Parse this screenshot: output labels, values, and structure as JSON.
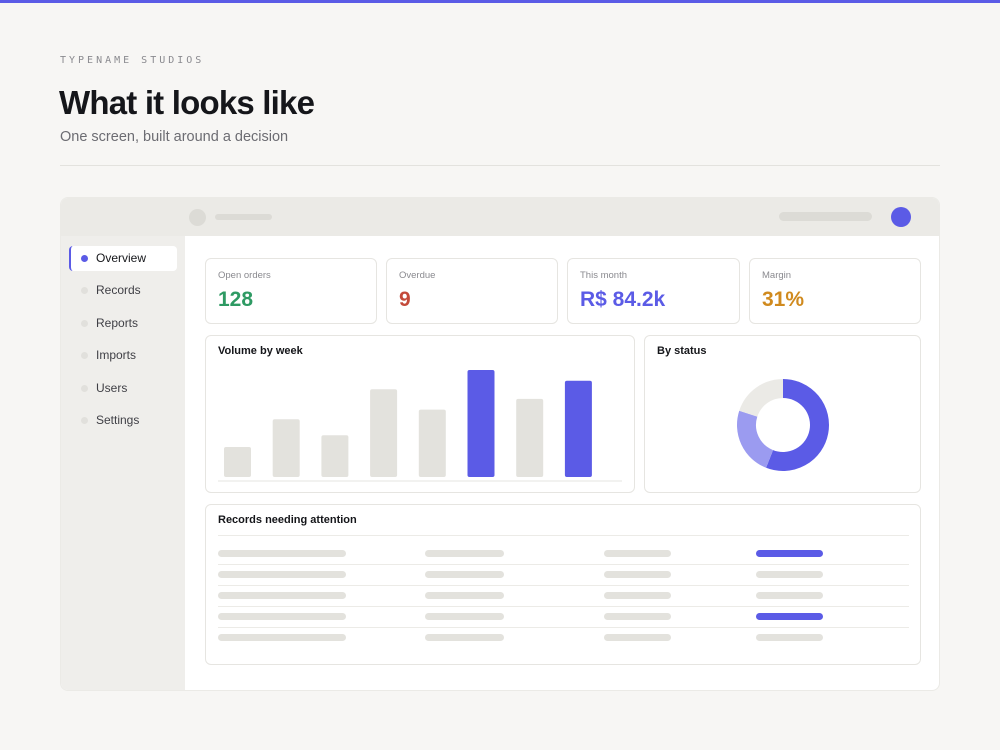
{
  "colors": {
    "accent": "#5b5be6",
    "placeholder": "#e3e2dd",
    "open_orders": "#2e9a63",
    "overdue": "#c44a3a",
    "this_month": "#5b5be6",
    "margin": "#d08a1e"
  },
  "header": {
    "eyebrow": "TYPENAME STUDIOS",
    "title": "What it looks like",
    "subtitle": "One screen, built around a decision"
  },
  "sidebar": {
    "items": [
      {
        "label": "Overview",
        "active": true
      },
      {
        "label": "Records",
        "active": false
      },
      {
        "label": "Reports",
        "active": false
      },
      {
        "label": "Imports",
        "active": false
      },
      {
        "label": "Users",
        "active": false
      },
      {
        "label": "Settings",
        "active": false
      }
    ]
  },
  "kpis": [
    {
      "label": "Open orders",
      "value": "128"
    },
    {
      "label": "Overdue",
      "value": "9"
    },
    {
      "label": "This month",
      "value": "R$ 84.2k"
    },
    {
      "label": "Margin",
      "value": "31%"
    }
  ],
  "volume_card": {
    "title": "Volume by week"
  },
  "status_card": {
    "title": "By status"
  },
  "records_card": {
    "title": "Records needing attention"
  },
  "chart_data": [
    {
      "type": "bar",
      "title": "Volume by week",
      "categories": [
        "",
        "",
        "",
        "",
        "",
        "",
        "",
        ""
      ],
      "values": [
        28,
        54,
        39,
        82,
        63,
        100,
        73,
        90
      ],
      "highlighted": [
        false,
        false,
        false,
        false,
        false,
        true,
        false,
        true
      ],
      "ylim": [
        0,
        100
      ]
    },
    {
      "type": "pie",
      "title": "By status",
      "values": [
        56,
        24,
        20
      ],
      "colors": [
        "#5b5be6",
        "#9b9bf0",
        "#ebeae6"
      ]
    }
  ],
  "table": {
    "rows": [
      {
        "status_highlight": true
      },
      {
        "status_highlight": false
      },
      {
        "status_highlight": false
      },
      {
        "status_highlight": true
      },
      {
        "status_highlight": false
      }
    ]
  }
}
